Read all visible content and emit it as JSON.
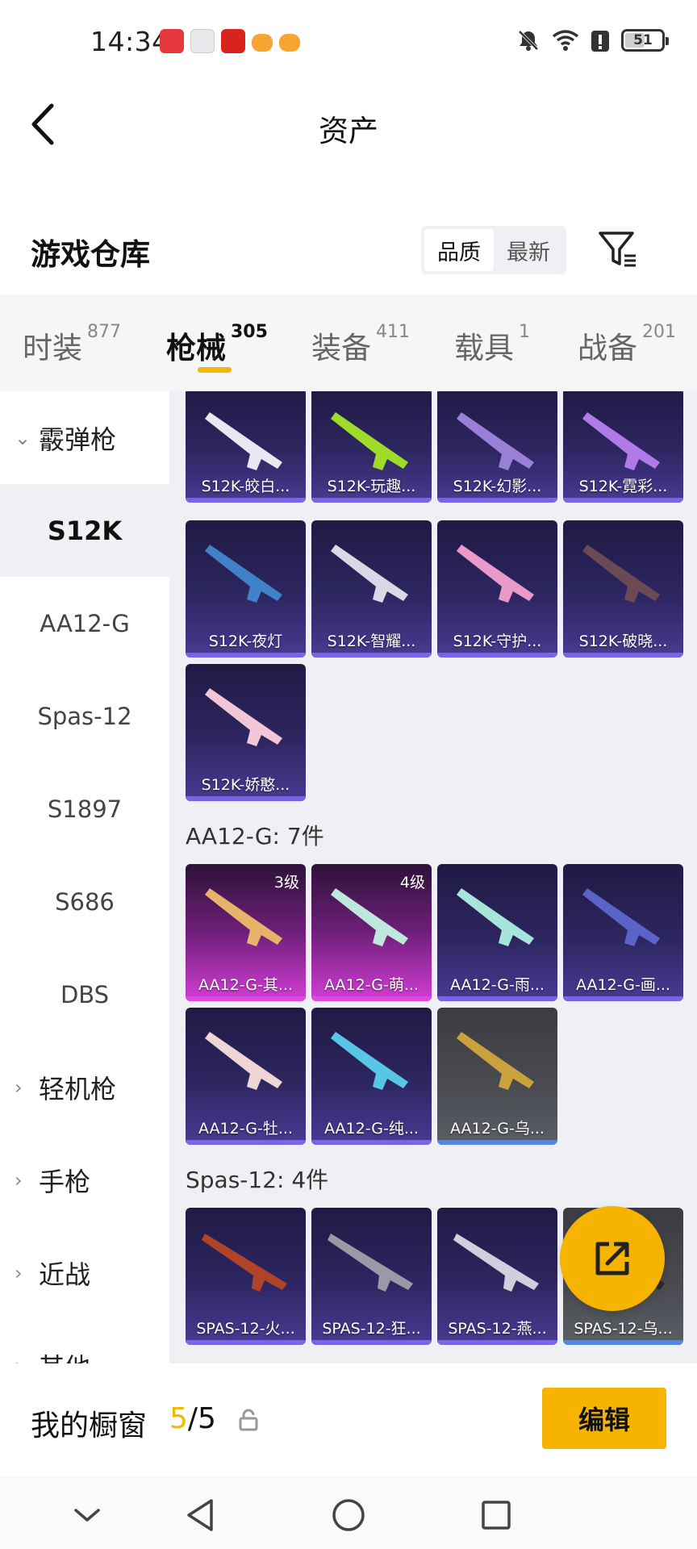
{
  "status_bar": {
    "time": "14:34",
    "battery": "51",
    "battery_level": 0.51,
    "icons": [
      "huawei-app-icon",
      "box-app-icon",
      "heart-app-icon",
      "cat-app-icon",
      "cat-app-icon",
      "mute-icon",
      "wifi-icon",
      "alert-icon",
      "battery-icon"
    ]
  },
  "header": {
    "title": "资产",
    "back_icon": "chevron-left-icon"
  },
  "warehouse": {
    "title": "游戏仓库",
    "sort_options": [
      "品质",
      "最新"
    ],
    "sort_selected": "品质",
    "filter_icon": "filter-icon"
  },
  "tabs": [
    {
      "label": "时装",
      "count": "877"
    },
    {
      "label": "枪械",
      "count": "305",
      "active": true
    },
    {
      "label": "装备",
      "count": "411"
    },
    {
      "label": "载具",
      "count": "1"
    },
    {
      "label": "战备",
      "count": "201"
    }
  ],
  "sidebar": {
    "groups": [
      {
        "label": "霰弹枪",
        "expanded": true
      },
      {
        "label": "轻机枪"
      },
      {
        "label": "手枪"
      },
      {
        "label": "近战"
      },
      {
        "label": "其他"
      }
    ],
    "sub_items": [
      "S12K",
      "AA12-G",
      "Spas-12",
      "S1897",
      "S686",
      "DBS"
    ],
    "active": "S12K"
  },
  "groups": [
    {
      "label": "",
      "items": [
        {
          "name": "S12K-皎白...",
          "rarity": "purple"
        },
        {
          "name": "S12K-玩趣...",
          "rarity": "purple"
        },
        {
          "name": "S12K-幻影...",
          "rarity": "purple"
        },
        {
          "name": "S12K-霓彩...",
          "rarity": "purple"
        },
        {
          "name": "S12K-夜灯",
          "rarity": "purple"
        },
        {
          "name": "S12K-智耀...",
          "rarity": "purple"
        },
        {
          "name": "S12K-守护...",
          "rarity": "purple"
        },
        {
          "name": "S12K-破晓...",
          "rarity": "purple"
        },
        {
          "name": "S12K-娇憨...",
          "rarity": "purple"
        }
      ]
    },
    {
      "label": "AA12-G: 7件",
      "items": [
        {
          "name": "AA12-G-其...",
          "rarity": "pink",
          "level": "3级"
        },
        {
          "name": "AA12-G-萌...",
          "rarity": "pink",
          "level": "4级"
        },
        {
          "name": "AA12-G-雨...",
          "rarity": "purple"
        },
        {
          "name": "AA12-G-画...",
          "rarity": "purple"
        },
        {
          "name": "AA12-G-牡...",
          "rarity": "purple"
        },
        {
          "name": "AA12-G-纯...",
          "rarity": "purple"
        },
        {
          "name": "AA12-G-乌...",
          "rarity": "gray"
        }
      ]
    },
    {
      "label": "Spas-12: 4件",
      "items": [
        {
          "name": "SPAS-12-火...",
          "rarity": "purple"
        },
        {
          "name": "SPAS-12-狂...",
          "rarity": "purple"
        },
        {
          "name": "SPAS-12-燕...",
          "rarity": "purple"
        },
        {
          "name": "SPAS-12-乌...",
          "rarity": "gray"
        }
      ]
    }
  ],
  "fab": {
    "icon": "share-icon"
  },
  "showcase": {
    "label": "我的橱窗",
    "current": "5",
    "total": "/5",
    "lock_icon": "lock-icon",
    "edit_label": "编辑"
  },
  "system_nav": [
    "chevron-down-icon",
    "back-triangle-icon",
    "home-circle-icon",
    "recents-square-icon"
  ],
  "colors": {
    "accent": "#f6b400",
    "tab_underline": "#f5b800",
    "purple_bar": "#7b63e8",
    "pink_bar": "#e049e0",
    "gray_bar": "#4f86e8"
  }
}
